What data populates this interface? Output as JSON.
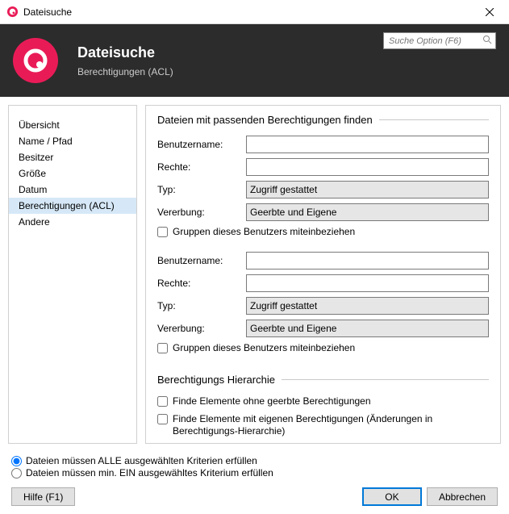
{
  "window": {
    "title": "Dateisuche",
    "close": "×"
  },
  "banner": {
    "title": "Dateisuche",
    "subtitle": "Berechtigungen (ACL)"
  },
  "search": {
    "placeholder": "Suche Option (F6)"
  },
  "sidebar": {
    "items": [
      "Übersicht",
      "Name / Pfad",
      "Besitzer",
      "Größe",
      "Datum",
      "Berechtigungen (ACL)",
      "Andere"
    ],
    "selected_index": 5
  },
  "group1": {
    "legend": "Dateien mit passenden Berechtigungen finden",
    "labels": {
      "benutzername": "Benutzername:",
      "rechte": "Rechte:",
      "typ": "Typ:",
      "vererbung": "Vererbung:",
      "include_groups": "Gruppen dieses Benutzers miteinbeziehen"
    },
    "block1": {
      "benutzername": "",
      "rechte": "",
      "typ": "Zugriff gestattet",
      "vererbung": "Geerbte und Eigene"
    },
    "block2": {
      "benutzername": "",
      "rechte": "",
      "typ": "Zugriff gestattet",
      "vererbung": "Geerbte und Eigene"
    }
  },
  "group2": {
    "legend": "Berechtigungs Hierarchie",
    "check1": "Finde Elemente ohne geerbte Berechtigungen",
    "check2": "Finde Elemente mit eigenen Berechtigungen (Änderungen in Berechtigungs-Hierarchie)"
  },
  "criteria": {
    "all": "Dateien müssen ALLE ausgewählten Kriterien erfüllen",
    "one": "Dateien müssen min. EIN ausgewähltes Kriterium erfüllen"
  },
  "buttons": {
    "help": "Hilfe (F1)",
    "ok": "OK",
    "cancel": "Abbrechen"
  }
}
